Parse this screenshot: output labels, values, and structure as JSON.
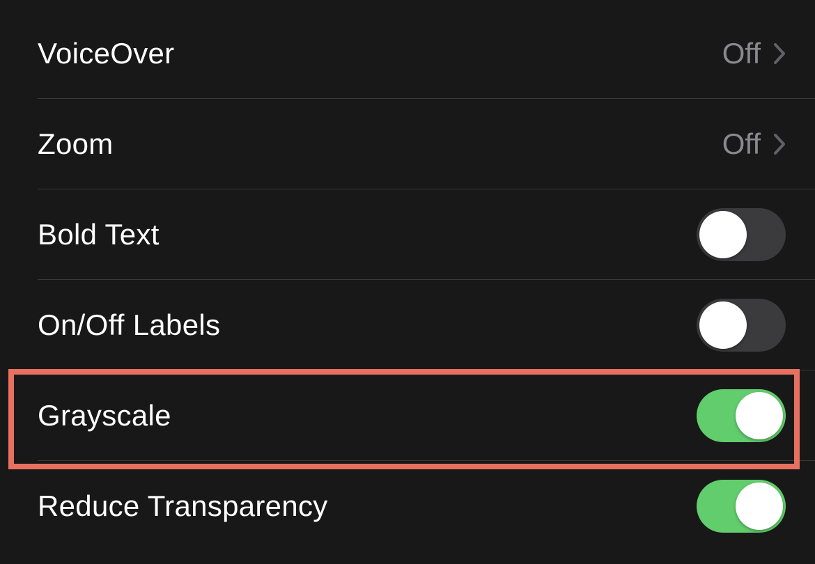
{
  "colors": {
    "highlight_border": "#e87060",
    "toggle_on": "#61cd6c",
    "toggle_off": "#3b3b3d",
    "background": "#181818"
  },
  "rows": [
    {
      "label": "VoiceOver",
      "type": "disclosure",
      "value": "Off"
    },
    {
      "label": "Zoom",
      "type": "disclosure",
      "value": "Off"
    },
    {
      "label": "Bold Text",
      "type": "toggle",
      "state": "off"
    },
    {
      "label": "On/Off Labels",
      "type": "toggle",
      "state": "off"
    },
    {
      "label": "Grayscale",
      "type": "toggle",
      "state": "on",
      "highlighted": true
    },
    {
      "label": "Reduce Transparency",
      "type": "toggle",
      "state": "on"
    }
  ]
}
